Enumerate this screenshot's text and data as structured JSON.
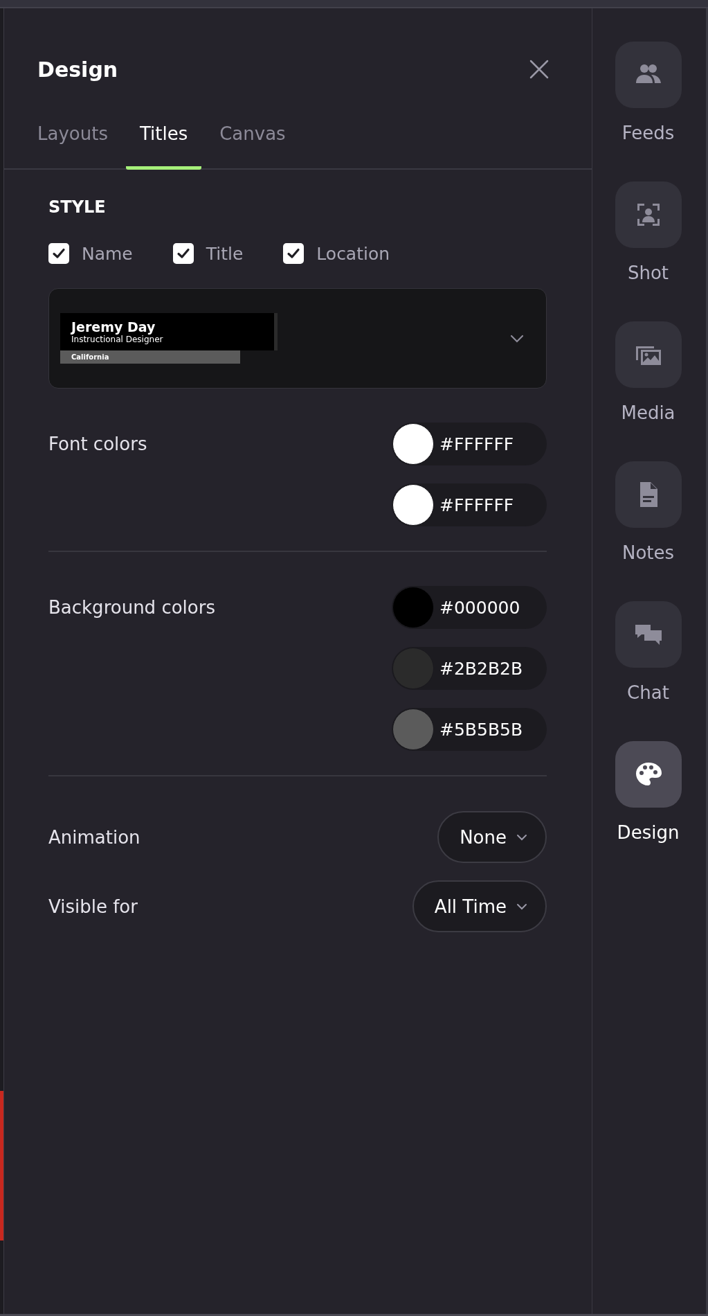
{
  "panel": {
    "title": "Design",
    "tabs": [
      {
        "label": "Layouts",
        "selected": false
      },
      {
        "label": "Titles",
        "selected": true
      },
      {
        "label": "Canvas",
        "selected": false
      }
    ],
    "style": {
      "heading": "STYLE",
      "options": [
        {
          "label": "Name",
          "checked": true
        },
        {
          "label": "Title",
          "checked": true
        },
        {
          "label": "Location",
          "checked": true
        }
      ],
      "preview": {
        "name": "Jeremy Day",
        "title": "Instructional Designer",
        "location": "California"
      }
    },
    "font_colors": {
      "label": "Font colors",
      "swatches": [
        {
          "color": "#ffffff",
          "value": "#FFFFFF"
        },
        {
          "color": "#ffffff",
          "value": "#FFFFFF"
        }
      ]
    },
    "background_colors": {
      "label": "Background colors",
      "swatches": [
        {
          "color": "#000000",
          "value": "#000000"
        },
        {
          "color": "#2b2b2b",
          "value": "#2B2B2B"
        },
        {
          "color": "#5b5b5b",
          "value": "#5B5B5B"
        }
      ]
    },
    "animation": {
      "label": "Animation",
      "value": "None"
    },
    "visible_for": {
      "label": "Visible for",
      "value": "All Time"
    }
  },
  "sidebar": {
    "items": [
      {
        "label": "Feeds",
        "selected": false
      },
      {
        "label": "Shot",
        "selected": false
      },
      {
        "label": "Media",
        "selected": false
      },
      {
        "label": "Notes",
        "selected": false
      },
      {
        "label": "Chat",
        "selected": false
      },
      {
        "label": "Design",
        "selected": true
      }
    ]
  }
}
